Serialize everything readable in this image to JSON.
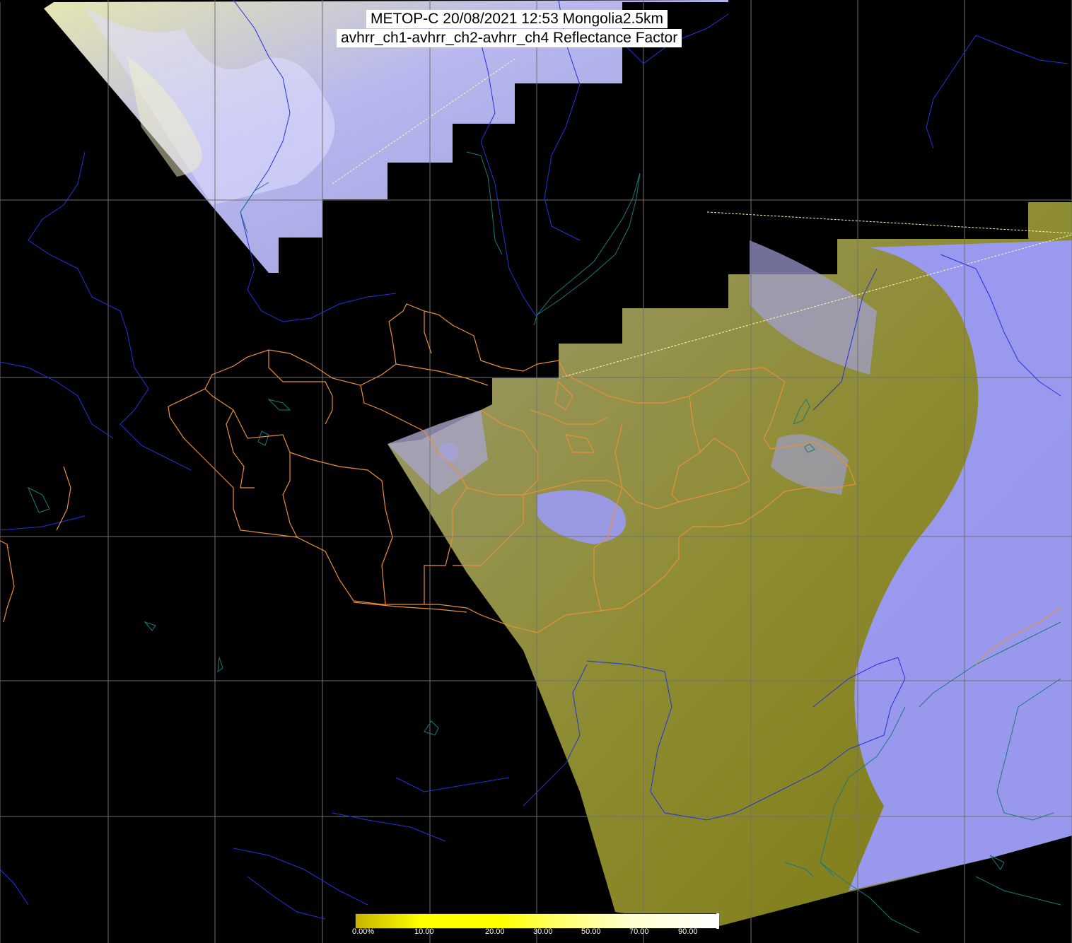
{
  "title": {
    "line1": "METOP-C 20/08/2021 12:53 Mongolia2.5km",
    "line2": "avhrr_ch1-avhrr_ch2-avhrr_ch4 Reflectance Factor"
  },
  "colorbar": {
    "labels": [
      "0.00%",
      "10.00",
      "20.00",
      "30.00",
      "50.00",
      "70.00",
      "90.00"
    ],
    "colors": [
      "#c8b400",
      "#ffff00",
      "#ffff66",
      "#ffffcc",
      "#ffffff"
    ]
  },
  "colors": {
    "background": "#000000",
    "grid": "#707070",
    "river": "#2233dd",
    "coast": "#116666",
    "border": "#e8903a",
    "cloud": "#9a9aff",
    "ground": "#8c8a1e"
  }
}
